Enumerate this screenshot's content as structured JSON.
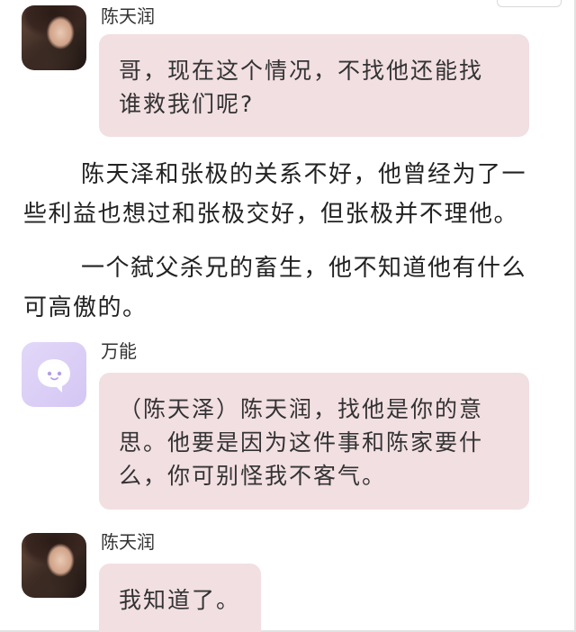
{
  "messages": [
    {
      "sender": "陈天润",
      "avatar_icon": "person-photo-avatar",
      "lines": [
        "哥，现在这个情况，不找他还能找",
        "谁救我们呢?"
      ]
    },
    {
      "sender": "万能",
      "avatar_icon": "chat-bubble-bot-avatar",
      "lines": [
        "（陈天泽）陈天润，找他是你的意",
        "思。他要是因为这件事和陈家要什",
        "么，你可别怪我不客气。"
      ]
    },
    {
      "sender": "陈天润",
      "avatar_icon": "person-photo-avatar",
      "lines": [
        "我知道了。"
      ]
    }
  ],
  "narration": [
    {
      "lines": [
        "陈天泽和张极的关系不好，他曾经为了一",
        "些利益也想过和张极交好，但张极并不理他。"
      ]
    },
    {
      "lines": [
        "一个弑父杀兄的畜生，他不知道他有什么",
        "可高傲的。"
      ]
    }
  ],
  "colors": {
    "bubble": "#f2dfe2",
    "bot_avatar": "#d9cdf6",
    "bot_icon": "#ffffff",
    "bot_dot": "#b59be8"
  }
}
